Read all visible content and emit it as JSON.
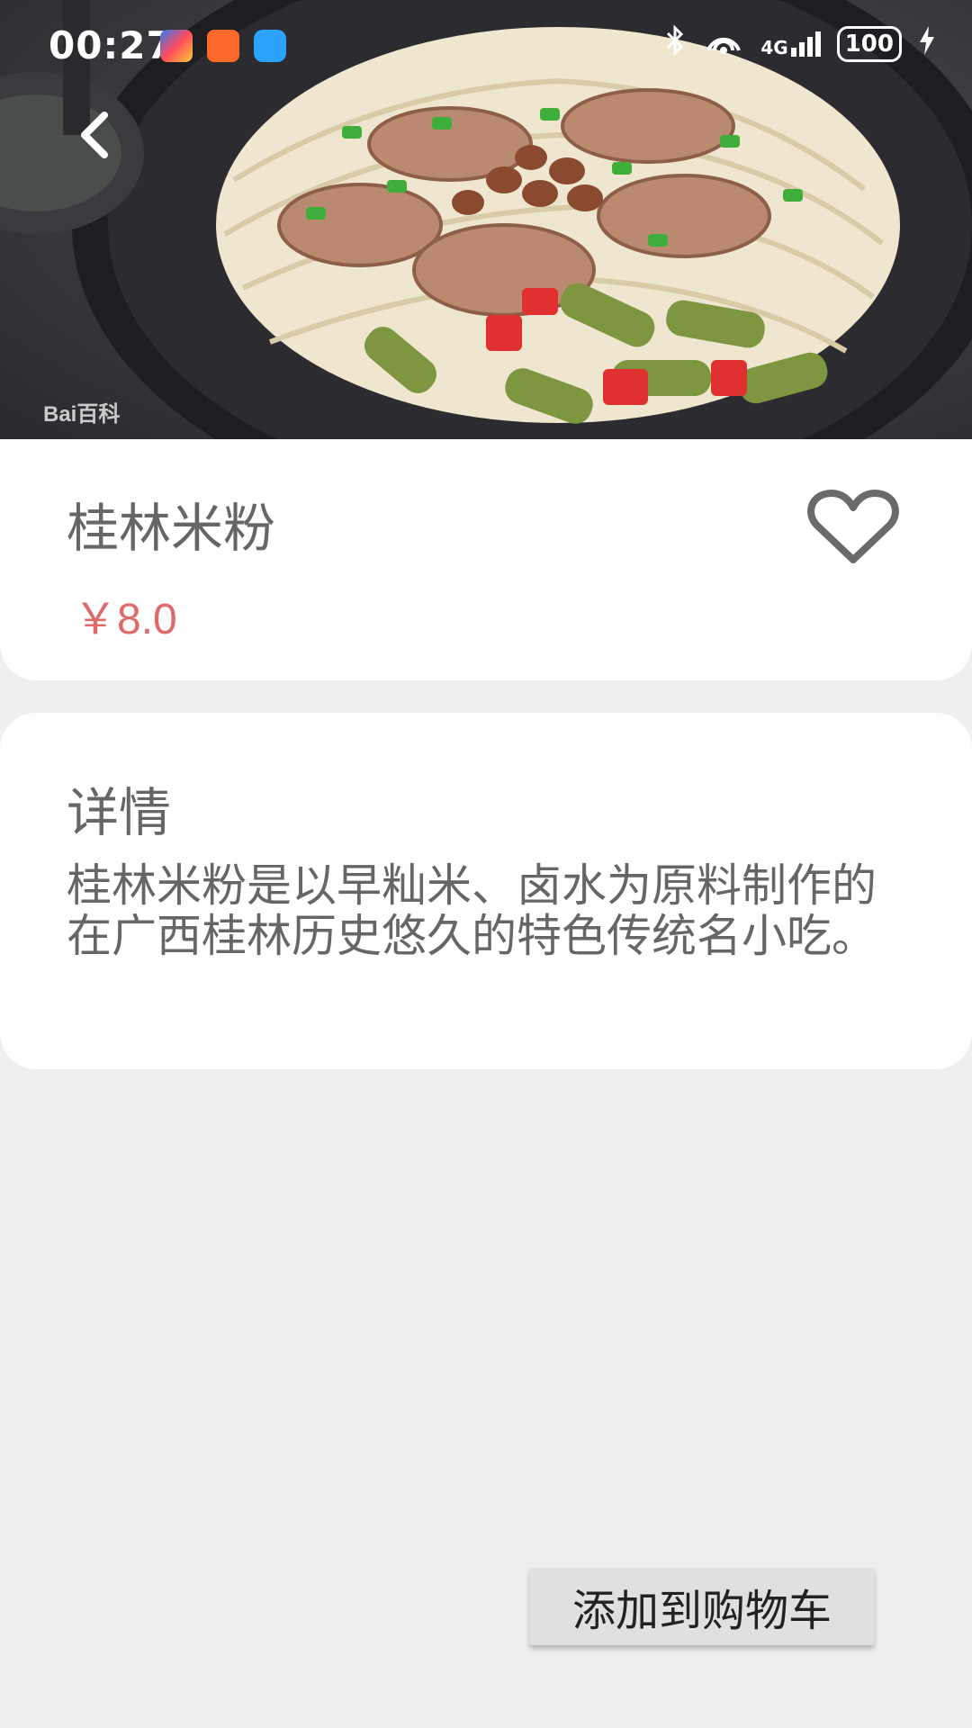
{
  "status_bar": {
    "time": "00:27",
    "signal_label": "4G",
    "battery": "100"
  },
  "hero": {
    "watermark": "Bai百科"
  },
  "dish": {
    "name": "桂林米粉",
    "price": "￥8.0"
  },
  "detail": {
    "title": "详情",
    "description": "桂林米粉是以早籼米、卤水为原料制作的在广西桂林历史悠久的特色传统名小吃。"
  },
  "actions": {
    "add_to_cart": "添加到购物车"
  },
  "colors": {
    "price": "#e06a6a",
    "background": "#efefef",
    "card": "#ffffff",
    "text_gray": "#666666"
  }
}
